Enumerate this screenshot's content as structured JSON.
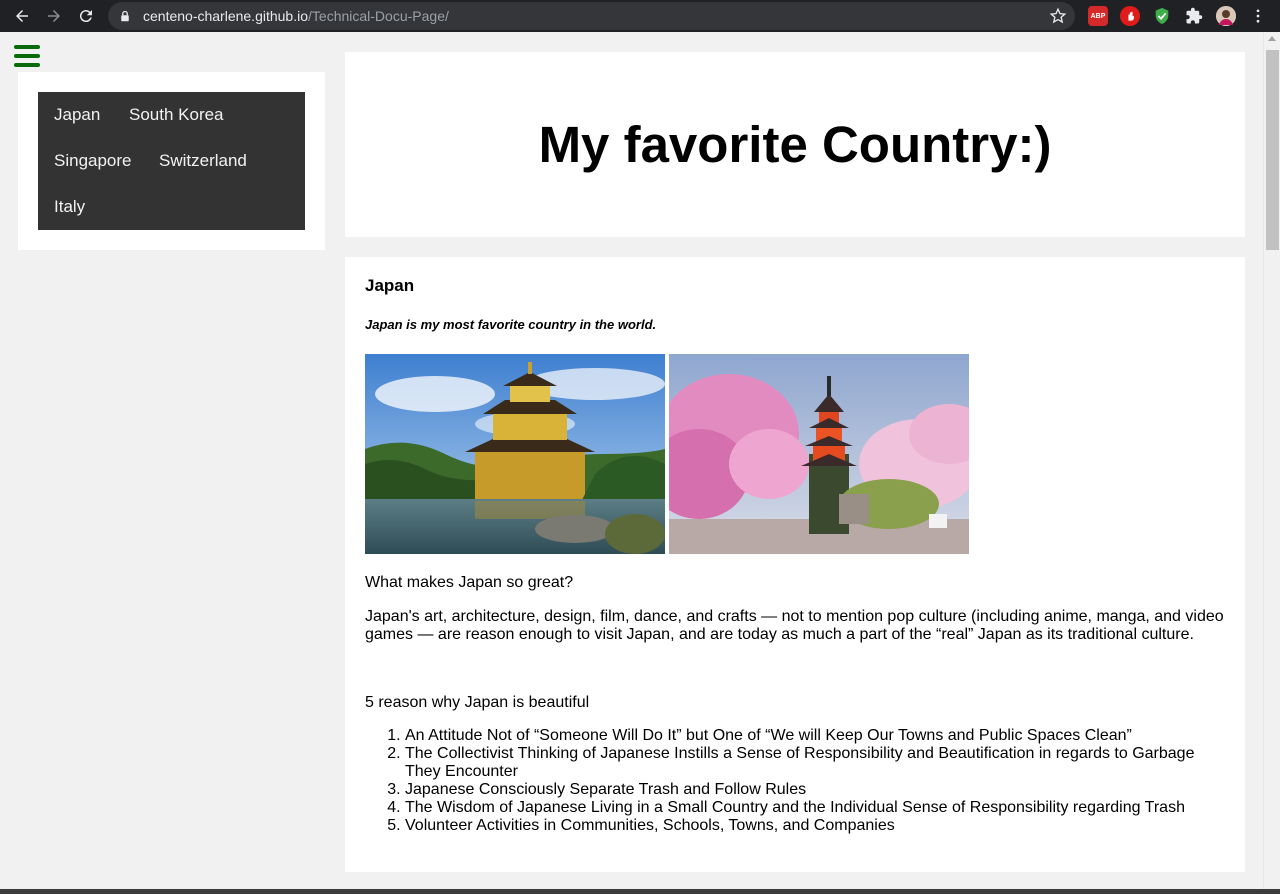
{
  "browser": {
    "url_host": "centeno-charlene.github.io",
    "url_path": "/Technical-Docu-Page/",
    "extensions": {
      "abp_label": "ABP"
    }
  },
  "sidebar": {
    "items": [
      {
        "label": "Japan"
      },
      {
        "label": "South Korea"
      },
      {
        "label": "Singapore"
      },
      {
        "label": "Switzerland"
      },
      {
        "label": "Italy"
      }
    ]
  },
  "header": {
    "title": "My favorite Country:)"
  },
  "main": {
    "section_title": "Japan",
    "tagline": "Japan is my most favorite country in the world.",
    "question": "What makes Japan so great?",
    "paragraph": "Japan's art, architecture, design, film, dance, and crafts — not to mention pop culture (including anime, manga, and video games — are reason enough to visit Japan, and are today as much a part of the “real” Japan as its traditional culture.",
    "reasons_title": "5 reason why Japan is beautiful",
    "reasons": [
      "An Attitude Not of “Someone Will Do It” but One of “We will Keep Our Towns and Public Spaces Clean”",
      "The Collectivist Thinking of Japanese Instills a Sense of Responsibility and Beautification in regards to Garbage They Encounter",
      "Japanese Consciously Separate Trash and Follow Rules",
      "The Wisdom of Japanese Living in a Small Country and the Individual Sense of Responsibility regarding Trash",
      "Volunteer Activities in Communities, Schools, Towns, and Companies"
    ]
  },
  "colors": {
    "nav_bg": "#333333",
    "hamburger": "#0a6b0a",
    "page_bg": "#f1f1f1"
  }
}
